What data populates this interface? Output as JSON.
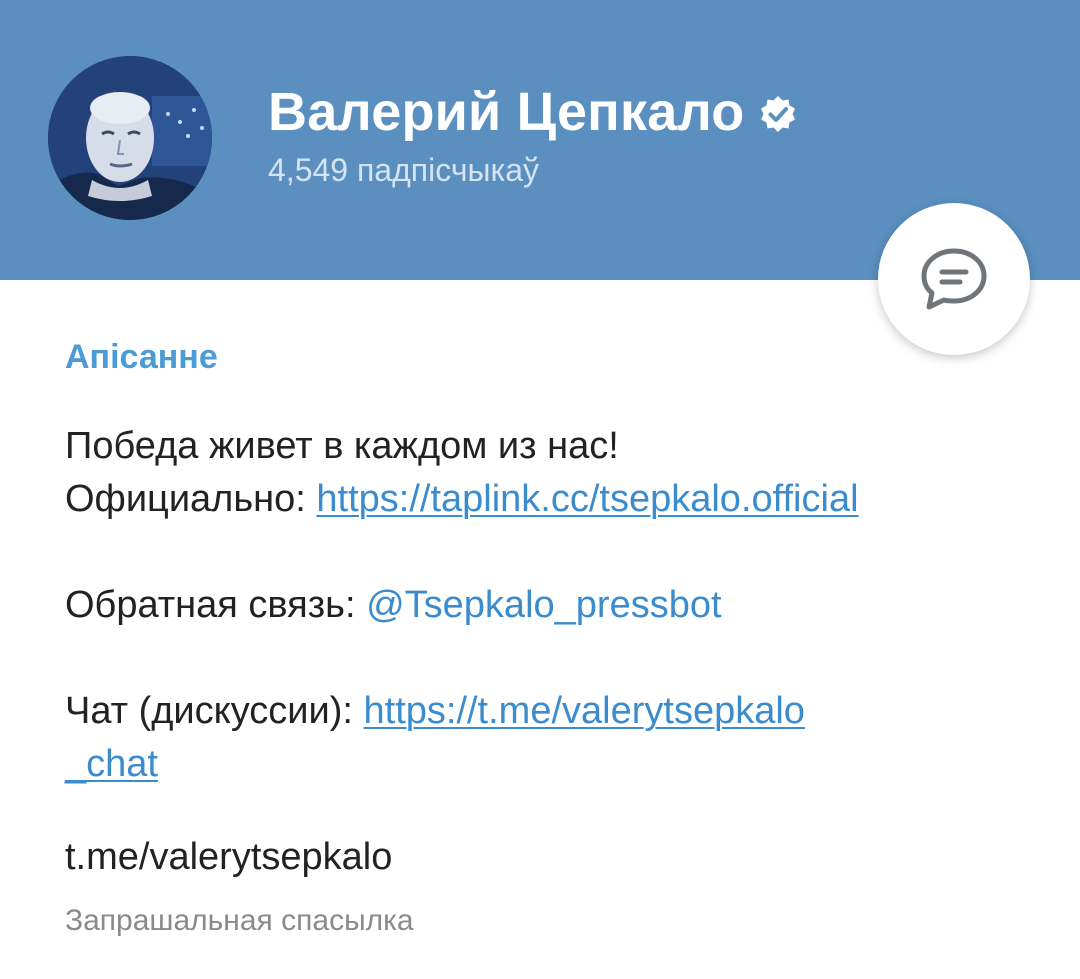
{
  "header": {
    "channel_name": "Валерий Цепкало",
    "subscribers": "4,549 падпісчыкаў",
    "background_color": "#5a8fbf",
    "verified_icon": "verified-badge-icon",
    "avatar": "channel-avatar-photo"
  },
  "chat_button": {
    "icon": "chat-bubble-icon"
  },
  "description": {
    "title": "Апісанне",
    "line1": "Победа живет в каждом из нас!",
    "official_label": "Официально:",
    "official_link": "https://taplink.cc/tsepkalo.official",
    "feedback_label": "Обратная связь:",
    "feedback_mention": "@Tsepkalo_pressbot",
    "chat_label": "Чат (дискуссии):",
    "chat_link_part1": "https://t.me/valerytsepkalo",
    "chat_link_part2": "_chat"
  },
  "username": {
    "value": "t.me/valerytsepkalo",
    "caption": "Запрашальная спасылка"
  },
  "colors": {
    "link": "#3a8ccf",
    "section_title": "#4b9cd6"
  }
}
